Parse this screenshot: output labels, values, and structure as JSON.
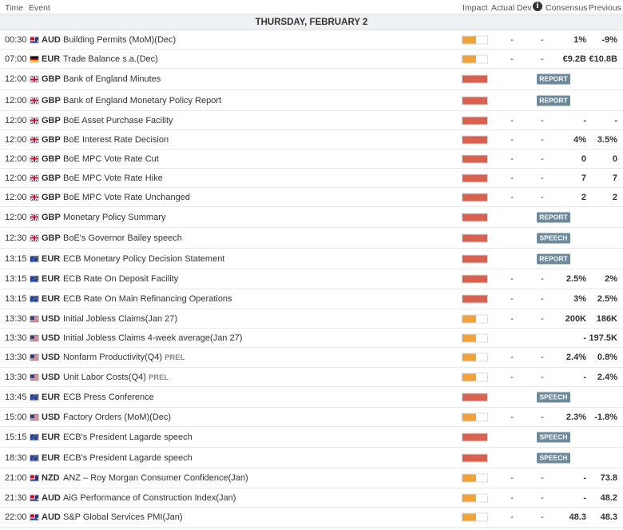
{
  "header": {
    "time": "Time",
    "event": "Event",
    "impact": "Impact",
    "actual": "Actual",
    "dev": "Dev",
    "info": "i",
    "consensus": "Consensus",
    "previous": "Previous"
  },
  "day_label": "THURSDAY, FEBRUARY 2",
  "colors": {
    "high": "#d9614f",
    "medium": "#f2a23a",
    "badge": "#6d8a9c"
  },
  "rows": [
    {
      "time": "00:30",
      "flag": "au",
      "currency": "AUD",
      "event": "Building Permits (MoM)(Dec)",
      "prel": "",
      "impact": "medium",
      "actual": "-",
      "dev": "-",
      "consensus": "1%",
      "previous": "-9%",
      "badge": ""
    },
    {
      "time": "07:00",
      "flag": "de",
      "currency": "EUR",
      "event": "Trade Balance s.a.(Dec)",
      "prel": "",
      "impact": "medium",
      "actual": "-",
      "dev": "-",
      "consensus": "€9.2B",
      "previous": "€10.8B",
      "badge": ""
    },
    {
      "time": "12:00",
      "flag": "gb",
      "currency": "GBP",
      "event": "Bank of England Minutes",
      "prel": "",
      "impact": "high",
      "actual": "",
      "dev": "",
      "consensus": "",
      "previous": "",
      "badge": "REPORT"
    },
    {
      "time": "12:00",
      "flag": "gb",
      "currency": "GBP",
      "event": "Bank of England Monetary Policy Report",
      "prel": "",
      "impact": "high",
      "actual": "",
      "dev": "",
      "consensus": "",
      "previous": "",
      "badge": "REPORT"
    },
    {
      "time": "12:00",
      "flag": "gb",
      "currency": "GBP",
      "event": "BoE Asset Purchase Facility",
      "prel": "",
      "impact": "high",
      "actual": "-",
      "dev": "-",
      "consensus": "-",
      "previous": "-",
      "badge": ""
    },
    {
      "time": "12:00",
      "flag": "gb",
      "currency": "GBP",
      "event": "BoE Interest Rate Decision",
      "prel": "",
      "impact": "high",
      "actual": "-",
      "dev": "-",
      "consensus": "4%",
      "previous": "3.5%",
      "badge": ""
    },
    {
      "time": "12:00",
      "flag": "gb",
      "currency": "GBP",
      "event": "BoE MPC Vote Rate Cut",
      "prel": "",
      "impact": "high",
      "actual": "-",
      "dev": "-",
      "consensus": "0",
      "previous": "0",
      "badge": ""
    },
    {
      "time": "12:00",
      "flag": "gb",
      "currency": "GBP",
      "event": "BoE MPC Vote Rate Hike",
      "prel": "",
      "impact": "high",
      "actual": "-",
      "dev": "-",
      "consensus": "7",
      "previous": "7",
      "badge": ""
    },
    {
      "time": "12:00",
      "flag": "gb",
      "currency": "GBP",
      "event": "BoE MPC Vote Rate Unchanged",
      "prel": "",
      "impact": "high",
      "actual": "-",
      "dev": "-",
      "consensus": "2",
      "previous": "2",
      "badge": ""
    },
    {
      "time": "12:00",
      "flag": "gb",
      "currency": "GBP",
      "event": "Monetary Policy Summary",
      "prel": "",
      "impact": "high",
      "actual": "",
      "dev": "",
      "consensus": "",
      "previous": "",
      "badge": "REPORT"
    },
    {
      "time": "12:30",
      "flag": "gb",
      "currency": "GBP",
      "event": "BoE's Governor Bailey speech",
      "prel": "",
      "impact": "high",
      "actual": "",
      "dev": "",
      "consensus": "",
      "previous": "",
      "badge": "SPEECH"
    },
    {
      "time": "13:15",
      "flag": "eu",
      "currency": "EUR",
      "event": "ECB Monetary Policy Decision Statement",
      "prel": "",
      "impact": "high",
      "actual": "",
      "dev": "",
      "consensus": "",
      "previous": "",
      "badge": "REPORT"
    },
    {
      "time": "13:15",
      "flag": "eu",
      "currency": "EUR",
      "event": "ECB Rate On Deposit Facility",
      "prel": "",
      "impact": "high",
      "actual": "-",
      "dev": "-",
      "consensus": "2.5%",
      "previous": "2%",
      "badge": ""
    },
    {
      "time": "13:15",
      "flag": "eu",
      "currency": "EUR",
      "event": "ECB Rate On Main Refinancing Operations",
      "prel": "",
      "impact": "high",
      "actual": "-",
      "dev": "-",
      "consensus": "3%",
      "previous": "2.5%",
      "badge": ""
    },
    {
      "time": "13:30",
      "flag": "us",
      "currency": "USD",
      "event": "Initial Jobless Claims(Jan 27)",
      "prel": "",
      "impact": "medium",
      "actual": "-",
      "dev": "-",
      "consensus": "200K",
      "previous": "186K",
      "badge": ""
    },
    {
      "time": "13:30",
      "flag": "us",
      "currency": "USD",
      "event": "Initial Jobless Claims 4-week average(Jan 27)",
      "prel": "",
      "impact": "medium",
      "actual": "",
      "dev": "",
      "consensus": "-",
      "previous": "197.5K",
      "badge": ""
    },
    {
      "time": "13:30",
      "flag": "us",
      "currency": "USD",
      "event": "Nonfarm Productivity(Q4)",
      "prel": "PREL",
      "impact": "medium",
      "actual": "-",
      "dev": "-",
      "consensus": "2.4%",
      "previous": "0.8%",
      "badge": ""
    },
    {
      "time": "13:30",
      "flag": "us",
      "currency": "USD",
      "event": "Unit Labor Costs(Q4)",
      "prel": "PREL",
      "impact": "medium",
      "actual": "-",
      "dev": "-",
      "consensus": "-",
      "previous": "2.4%",
      "badge": ""
    },
    {
      "time": "13:45",
      "flag": "eu",
      "currency": "EUR",
      "event": "ECB Press Conference",
      "prel": "",
      "impact": "high",
      "actual": "",
      "dev": "",
      "consensus": "",
      "previous": "",
      "badge": "SPEECH"
    },
    {
      "time": "15:00",
      "flag": "us",
      "currency": "USD",
      "event": "Factory Orders (MoM)(Dec)",
      "prel": "",
      "impact": "medium",
      "actual": "-",
      "dev": "-",
      "consensus": "2.3%",
      "previous": "-1.8%",
      "badge": ""
    },
    {
      "time": "15:15",
      "flag": "eu",
      "currency": "EUR",
      "event": "ECB's President Lagarde speech",
      "prel": "",
      "impact": "high",
      "actual": "",
      "dev": "",
      "consensus": "",
      "previous": "",
      "badge": "SPEECH"
    },
    {
      "time": "18:30",
      "flag": "eu",
      "currency": "EUR",
      "event": "ECB's President Lagarde speech",
      "prel": "",
      "impact": "high",
      "actual": "",
      "dev": "",
      "consensus": "",
      "previous": "",
      "badge": "SPEECH"
    },
    {
      "time": "21:00",
      "flag": "nz",
      "currency": "NZD",
      "event": "ANZ – Roy Morgan Consumer Confidence(Jan)",
      "prel": "",
      "impact": "medium",
      "actual": "-",
      "dev": "-",
      "consensus": "-",
      "previous": "73.8",
      "badge": ""
    },
    {
      "time": "21:30",
      "flag": "au",
      "currency": "AUD",
      "event": "AiG Performance of Construction Index(Jan)",
      "prel": "",
      "impact": "medium",
      "actual": "-",
      "dev": "-",
      "consensus": "-",
      "previous": "48.2",
      "badge": ""
    },
    {
      "time": "22:00",
      "flag": "au",
      "currency": "AUD",
      "event": "S&P Global Services PMI(Jan)",
      "prel": "",
      "impact": "medium",
      "actual": "-",
      "dev": "-",
      "consensus": "48.3",
      "previous": "48.3",
      "badge": ""
    }
  ]
}
